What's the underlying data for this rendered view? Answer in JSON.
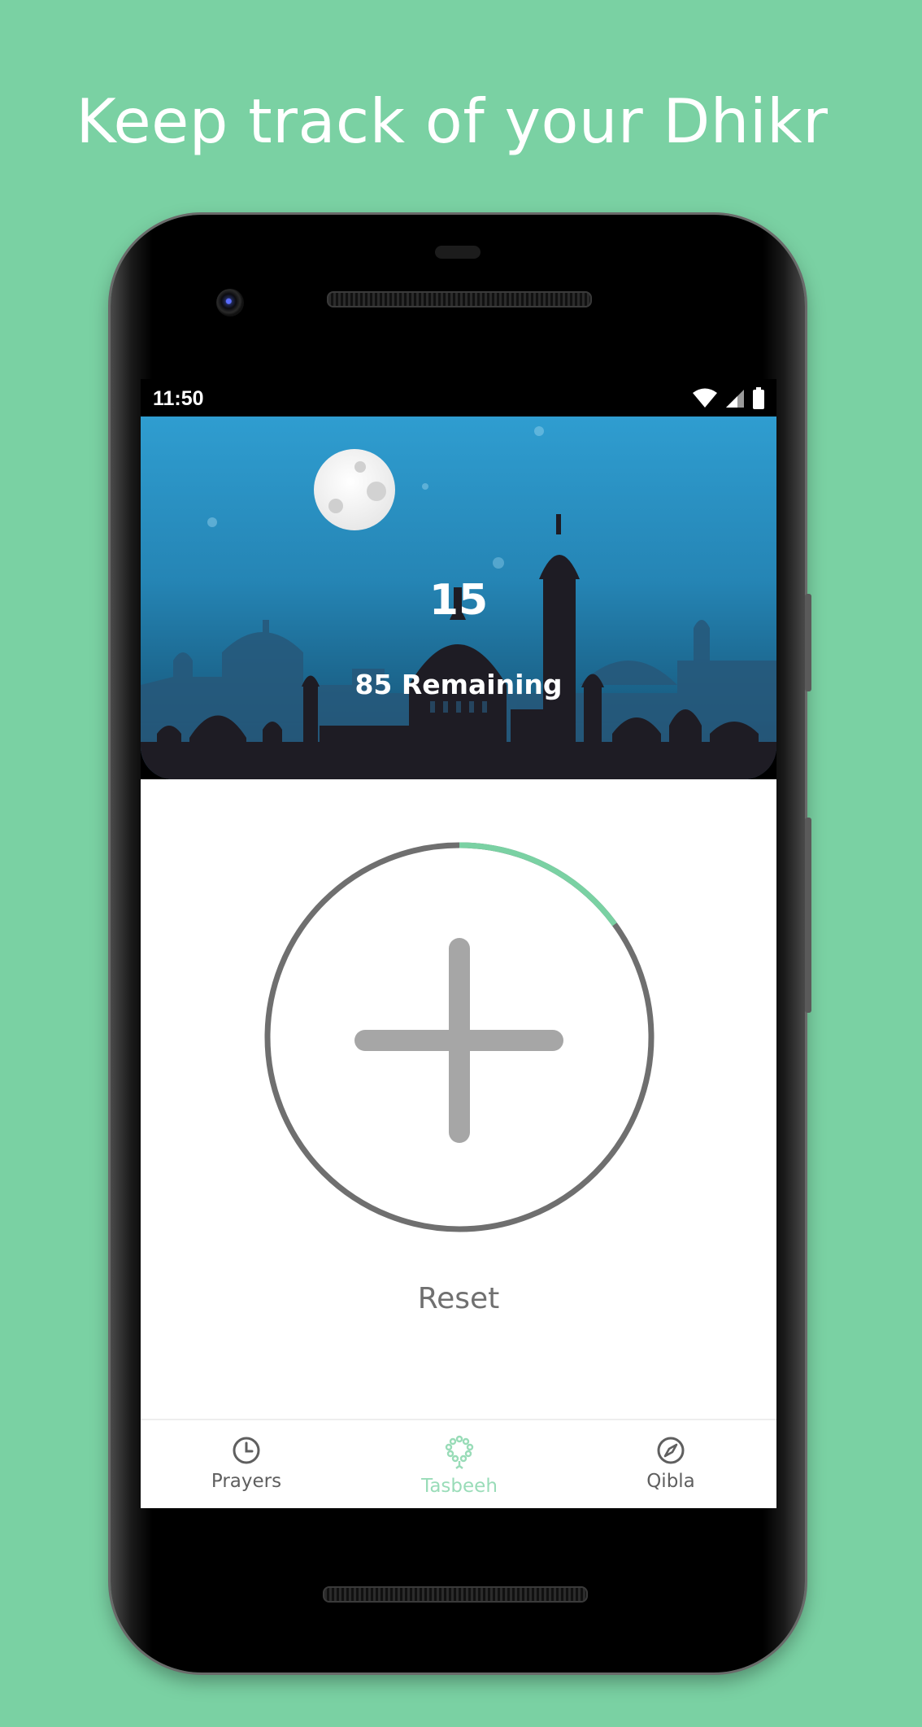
{
  "headline": "Keep track of your Dhikr",
  "status_bar": {
    "time": "11:50",
    "icons": [
      "wifi-icon",
      "signal-icon",
      "battery-icon"
    ]
  },
  "counter": {
    "count": "15",
    "remaining_text": "85 Remaining",
    "progress_fraction": 0.15,
    "increment_icon": "plus-icon"
  },
  "reset_label": "Reset",
  "bottom_nav": {
    "items": [
      {
        "label": "Prayers",
        "icon": "clock-icon",
        "active": false
      },
      {
        "label": "Tasbeeh",
        "icon": "prayer-beads-icon",
        "active": true
      },
      {
        "label": "Qibla",
        "icon": "compass-icon",
        "active": false
      }
    ]
  },
  "colors": {
    "background": "#7ad1a3",
    "accent": "#7ad1a3",
    "active_nav": "#99dcb8",
    "ring": "#6f6f6f",
    "plus": "#a6a6a6"
  }
}
